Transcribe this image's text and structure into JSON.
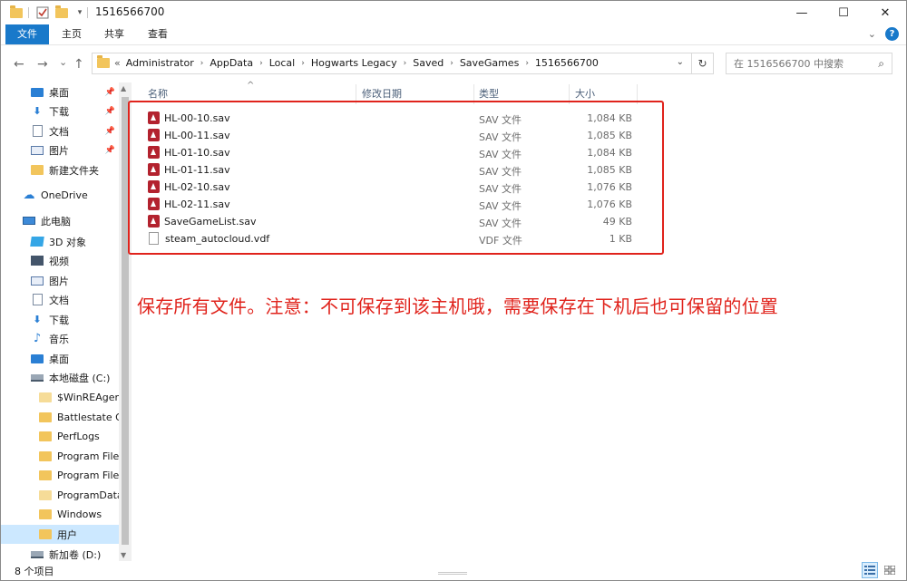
{
  "window": {
    "title": "1516566700",
    "controls": {
      "minimize": "—",
      "maximize": "☐",
      "close": "✕"
    }
  },
  "ribbon": {
    "tabs": [
      "文件",
      "主页",
      "共享",
      "查看"
    ],
    "expand_icon": "chevron-down-icon",
    "help_icon": "help-icon"
  },
  "navigation": {
    "back": "←",
    "forward": "→",
    "recent": "⌄",
    "up": "↑",
    "breadcrumb_prefix": "«",
    "breadcrumbs": [
      "Administrator",
      "AppData",
      "Local",
      "Hogwarts Legacy",
      "Saved",
      "SaveGames",
      "1516566700"
    ],
    "refresh": "↻",
    "search_placeholder": "在 1516566700 中搜索"
  },
  "sidebar": {
    "quick_access": [
      {
        "label": "桌面",
        "icon": "desktop-icon",
        "pinned": true
      },
      {
        "label": "下载",
        "icon": "download-icon",
        "pinned": true
      },
      {
        "label": "文档",
        "icon": "document-icon",
        "pinned": true
      },
      {
        "label": "图片",
        "icon": "picture-icon",
        "pinned": true
      },
      {
        "label": "新建文件夹",
        "icon": "folder-icon",
        "pinned": false
      }
    ],
    "onedrive": "OneDrive",
    "this_pc": "此电脑",
    "pc_items": [
      {
        "label": "3D 对象",
        "icon": "3d-objects-icon"
      },
      {
        "label": "视频",
        "icon": "video-icon"
      },
      {
        "label": "图片",
        "icon": "picture-icon"
      },
      {
        "label": "文档",
        "icon": "document-icon"
      },
      {
        "label": "下载",
        "icon": "download-icon"
      },
      {
        "label": "音乐",
        "icon": "music-icon"
      },
      {
        "label": "桌面",
        "icon": "desktop-icon"
      }
    ],
    "local_disk": "本地磁盘 (C:)",
    "c_items": [
      "$WinREAgent",
      "Battlestate Ga",
      "PerfLogs",
      "Program Files",
      "Program Files",
      "ProgramData",
      "Windows",
      "用户"
    ],
    "new_volume": "新加卷 (D:)"
  },
  "columns": {
    "name": "名称",
    "modified": "修改日期",
    "type": "类型",
    "size": "大小"
  },
  "files": [
    {
      "name": "HL-00-10.sav",
      "type": "SAV 文件",
      "size": "1,084 KB",
      "icon": "sav-file-icon"
    },
    {
      "name": "HL-00-11.sav",
      "type": "SAV 文件",
      "size": "1,085 KB",
      "icon": "sav-file-icon"
    },
    {
      "name": "HL-01-10.sav",
      "type": "SAV 文件",
      "size": "1,084 KB",
      "icon": "sav-file-icon"
    },
    {
      "name": "HL-01-11.sav",
      "type": "SAV 文件",
      "size": "1,085 KB",
      "icon": "sav-file-icon"
    },
    {
      "name": "HL-02-10.sav",
      "type": "SAV 文件",
      "size": "1,076 KB",
      "icon": "sav-file-icon"
    },
    {
      "name": "HL-02-11.sav",
      "type": "SAV 文件",
      "size": "1,076 KB",
      "icon": "sav-file-icon"
    },
    {
      "name": "SaveGameList.sav",
      "type": "SAV 文件",
      "size": "49 KB",
      "icon": "sav-file-icon"
    },
    {
      "name": "steam_autocloud.vdf",
      "type": "VDF 文件",
      "size": "1 KB",
      "icon": "document-file-icon"
    }
  ],
  "annotation": "保存所有文件。注意：不可保存到该主机哦，需要保存在下机后也可保留的位置",
  "colors": {
    "accent": "#1979ca",
    "annotation": "#e0231c",
    "selection": "#cce8ff"
  },
  "status": {
    "item_count": "8 个项目"
  }
}
